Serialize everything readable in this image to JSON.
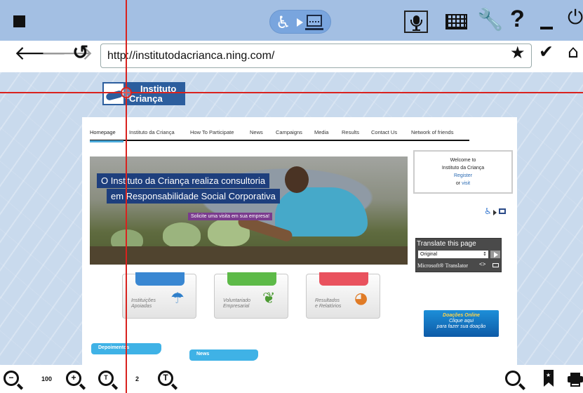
{
  "toolbar": {
    "help_label": "?"
  },
  "nav": {
    "url": "http://institutodacrianca.ning.com/"
  },
  "site": {
    "logo": {
      "line1": "Instituto",
      "da": "da",
      "line2": "Criança"
    },
    "menu": [
      "Homepage",
      "Instituto da Criança",
      "How To Participate",
      "News",
      "Campaigns",
      "Media",
      "Results",
      "Contact Us",
      "Network of friends"
    ],
    "hero": {
      "line1": "O Instituto da Criança realiza consultoria",
      "line2": "em Responsabilidade Social Corporativa",
      "cta": "Solicite uma visita em sua empresa!"
    },
    "welcome": {
      "line1": "Welcome to",
      "line2": "Instituto da Criança",
      "register": "Register",
      "or": "or",
      "sign_in": "visit"
    },
    "translate": {
      "title": "Translate this page",
      "selected": "Original",
      "provider": "Microsoft® Translator"
    },
    "cards": [
      {
        "line1": "Instituições",
        "line2": "Apoiadas",
        "icon": "umbrella-icon"
      },
      {
        "line1": "Voluntariado",
        "line2": "Empresarial",
        "icon": "sprout-icon"
      },
      {
        "line1": "Resultados",
        "line2": "e Relatórios",
        "icon": "pie-icon"
      }
    ],
    "donate": {
      "line1": "Doações Online",
      "line2": "Clique aqui",
      "line3": "para fazer sua doação"
    },
    "ribbons": {
      "depoimentos": "Depoimentos",
      "news": "News"
    }
  },
  "bottom": {
    "zoom_value": "100",
    "text_size": "2"
  },
  "colors": {
    "toolbar_bg": "#a3bfe3",
    "crosshair": "#d9221e",
    "site_blue": "#2c5e9e"
  }
}
